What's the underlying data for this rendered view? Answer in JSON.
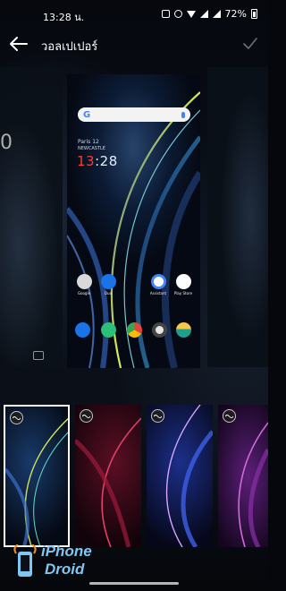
{
  "status_bar": {
    "time": "13:28 น.",
    "battery_pct": "72%"
  },
  "header": {
    "title": "วอลเปเปอร์"
  },
  "left_ghost": {
    "clock_fragment": "0"
  },
  "preview": {
    "date": "Paris 12",
    "city": "NEWCASTLE",
    "clock_hh": "13",
    "clock_mm": ":28",
    "apps_row1": [
      {
        "label": "Google",
        "icon": "google-folder-icon"
      },
      {
        "label": "Duo",
        "icon": "duo-icon"
      },
      {
        "label": "Assistant",
        "icon": "assistant-icon"
      },
      {
        "label": "Play Store",
        "icon": "play-store-icon"
      }
    ],
    "dock": [
      {
        "icon": "phone-icon"
      },
      {
        "icon": "messages-icon"
      },
      {
        "icon": "chrome-icon"
      },
      {
        "icon": "camera-icon"
      },
      {
        "icon": "weather-icon"
      }
    ]
  },
  "thumbnails": [
    {
      "name": "wallpaper-blue-teal",
      "selected": true
    },
    {
      "name": "wallpaper-red"
    },
    {
      "name": "wallpaper-blue-purple"
    },
    {
      "name": "wallpaper-purple"
    }
  ],
  "watermark": {
    "line1": "iPhone",
    "line2": "Droid"
  },
  "colors": {
    "accent_red": "#ff3b30",
    "watermark_blue": "#7fc6f1"
  }
}
